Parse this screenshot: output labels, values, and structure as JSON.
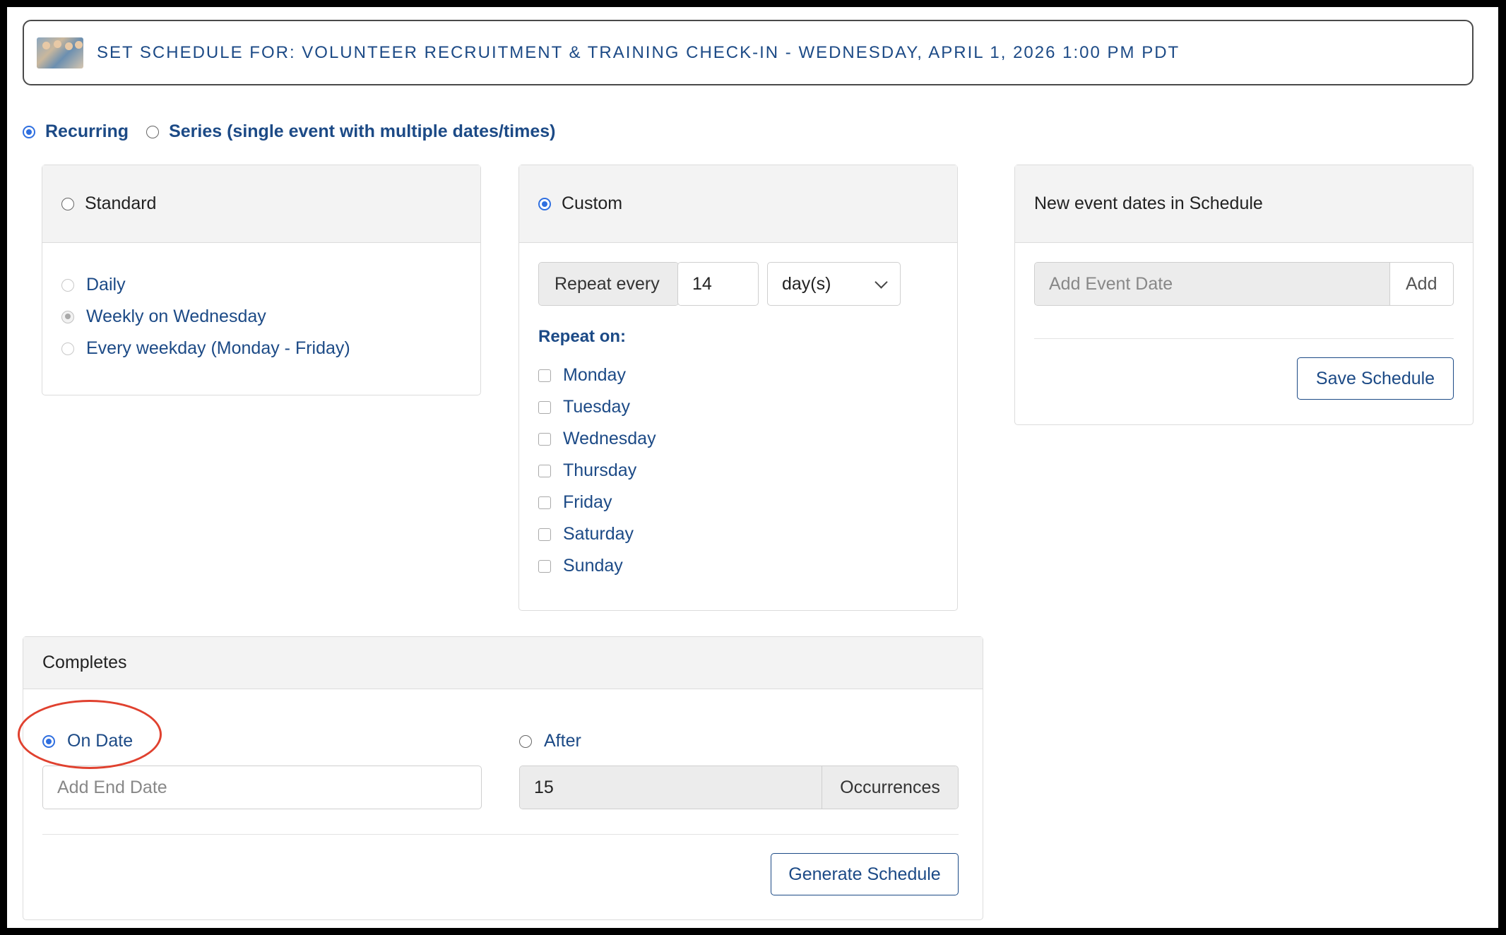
{
  "header": {
    "title": "SET SCHEDULE FOR: VOLUNTEER RECRUITMENT & TRAINING CHECK-IN - WEDNESDAY, APRIL 1, 2026 1:00 PM PDT",
    "thumbnail_icon": "event-photo-thumbnail"
  },
  "schedule_type": {
    "recurring_label": "Recurring",
    "series_label": "Series (single event with multiple dates/times)",
    "selected": "Recurring"
  },
  "standard": {
    "title": "Standard",
    "options": [
      "Daily",
      "Weekly on Wednesday",
      "Every weekday (Monday - Friday)"
    ],
    "selected_option": "Weekly on Wednesday"
  },
  "custom": {
    "title": "Custom",
    "repeat_every_label": "Repeat every",
    "repeat_every_value": "14",
    "unit_value": "day(s)",
    "repeat_on_label": "Repeat on:",
    "days": [
      "Monday",
      "Tuesday",
      "Wednesday",
      "Thursday",
      "Friday",
      "Saturday",
      "Sunday"
    ]
  },
  "new_dates": {
    "title": "New event dates in Schedule",
    "add_date_placeholder": "Add Event Date",
    "add_button": "Add",
    "save_button": "Save Schedule"
  },
  "completes": {
    "title": "Completes",
    "on_date_label": "On Date",
    "end_date_placeholder": "Add End Date",
    "after_label": "After",
    "occurrences_value": "15",
    "occurrences_label": "Occurrences",
    "selected": "On Date",
    "generate_button": "Generate Schedule"
  },
  "colors": {
    "accent_blue": "#2f6fe0",
    "text_blue": "#1c4a86",
    "annotation_red": "#e0412f"
  }
}
